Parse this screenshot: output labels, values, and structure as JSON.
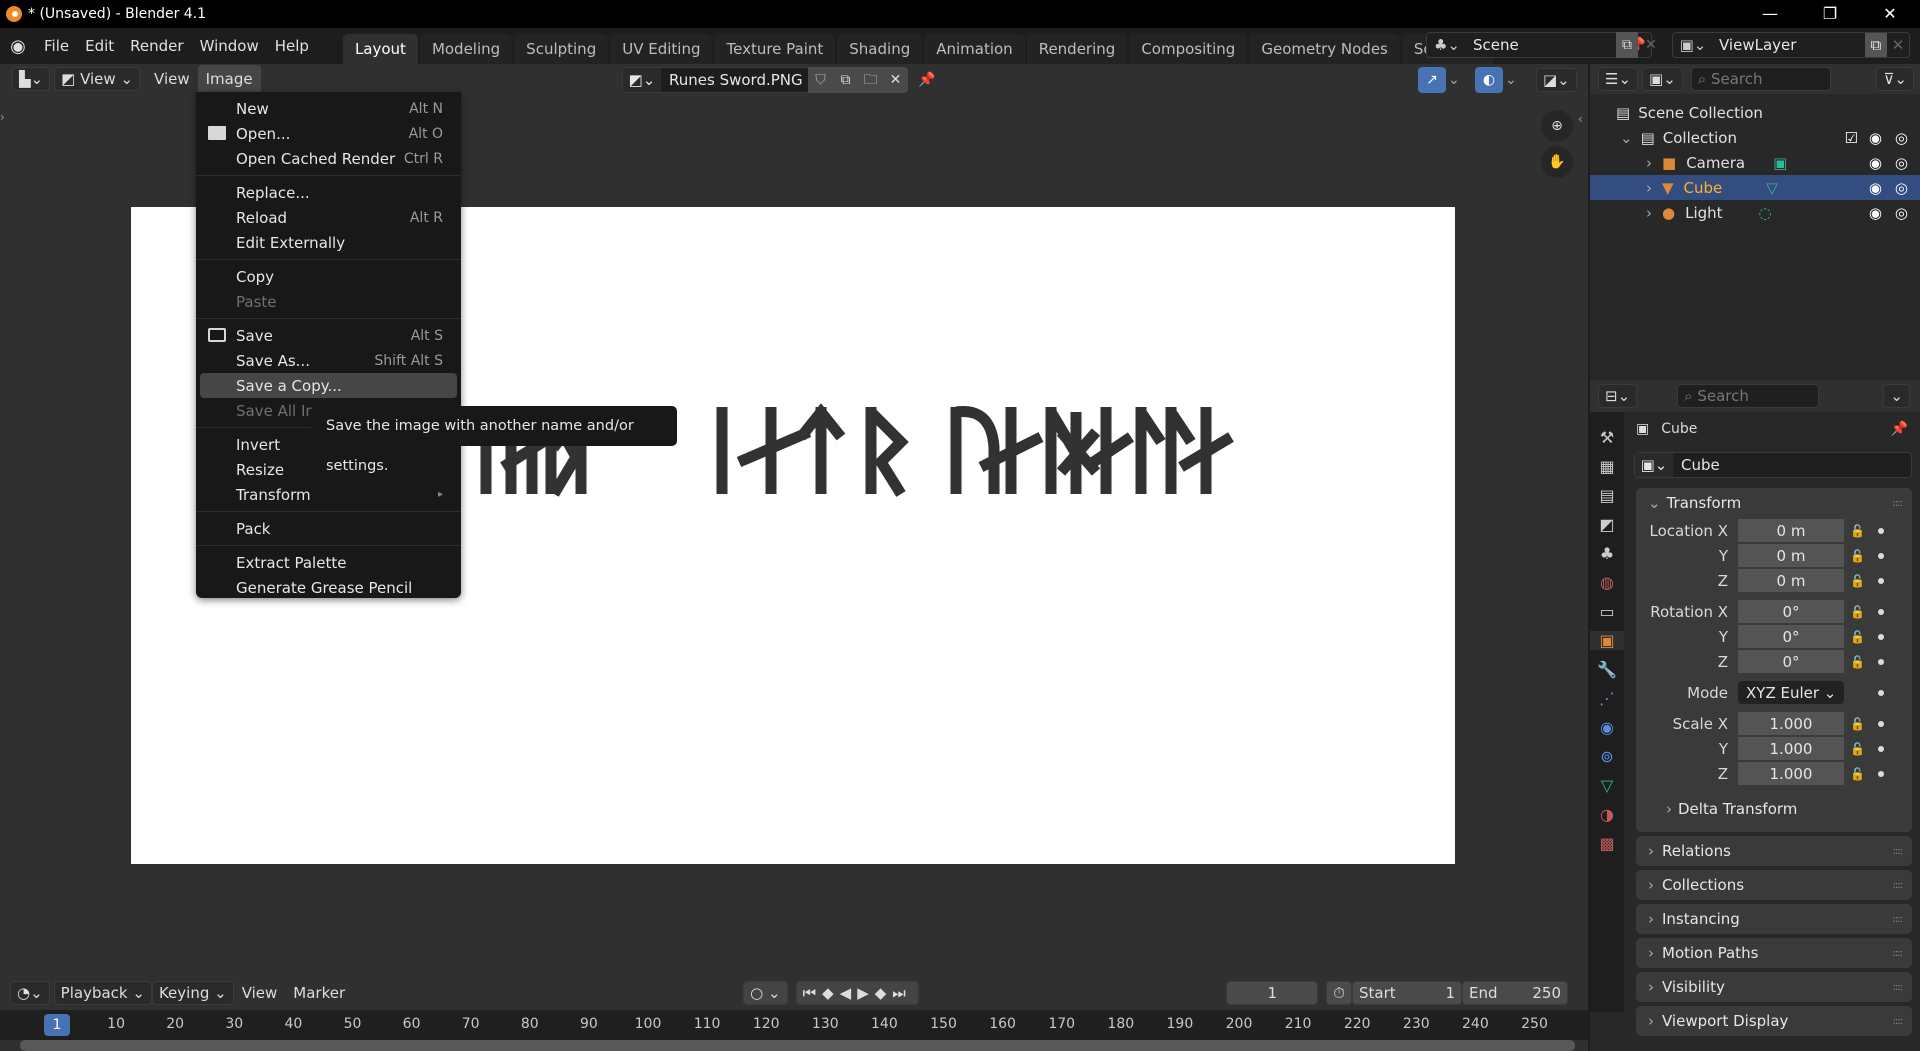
{
  "window": {
    "title": "* (Unsaved) - Blender 4.1",
    "controls": [
      "minimize",
      "restore",
      "close"
    ]
  },
  "topbar": {
    "menus": [
      "File",
      "Edit",
      "Render",
      "Window",
      "Help"
    ],
    "workspaces": [
      "Layout",
      "Modeling",
      "Sculpting",
      "UV Editing",
      "Texture Paint",
      "Shading",
      "Animation",
      "Rendering",
      "Compositing",
      "Geometry Nodes",
      "Scripting"
    ],
    "active_workspace": "Layout",
    "add_tab": "+",
    "scene": "Scene",
    "view_layer": "ViewLayer"
  },
  "image_editor": {
    "mode_dropdown": "View",
    "menus": [
      "View",
      "Image"
    ],
    "active_menu": "Image",
    "image_name": "Runes Sword.PNG"
  },
  "image_menu": {
    "items": [
      {
        "label": "New",
        "shortcut": "Alt N",
        "icon": ""
      },
      {
        "label": "Open...",
        "shortcut": "Alt O",
        "icon": "folder-icon"
      },
      {
        "label": "Open Cached Render",
        "shortcut": "Ctrl R",
        "icon": ""
      },
      {
        "sep": true
      },
      {
        "label": "Replace...",
        "shortcut": "",
        "icon": ""
      },
      {
        "label": "Reload",
        "shortcut": "Alt R",
        "icon": ""
      },
      {
        "label": "Edit Externally",
        "shortcut": "",
        "icon": ""
      },
      {
        "sep": true
      },
      {
        "label": "Copy",
        "shortcut": "",
        "icon": ""
      },
      {
        "label": "Paste",
        "shortcut": "",
        "icon": "",
        "disabled": true
      },
      {
        "sep": true
      },
      {
        "label": "Save",
        "shortcut": "Alt S",
        "icon": "save-icon"
      },
      {
        "label": "Save As...",
        "shortcut": "Shift Alt S",
        "icon": ""
      },
      {
        "label": "Save a Copy...",
        "shortcut": "",
        "icon": "",
        "highlighted": true
      },
      {
        "label": "Save All Images",
        "shortcut": "",
        "icon": "",
        "disabled": true
      },
      {
        "sep": true
      },
      {
        "label": "Invert",
        "shortcut": "",
        "icon": ""
      },
      {
        "label": "Resize",
        "shortcut": "",
        "icon": ""
      },
      {
        "label": "Transform",
        "shortcut": "▸",
        "icon": ""
      },
      {
        "sep": true
      },
      {
        "label": "Pack",
        "shortcut": "",
        "icon": ""
      },
      {
        "sep": true
      },
      {
        "label": "Extract Palette",
        "shortcut": "",
        "icon": ""
      },
      {
        "label": "Generate Grease Pencil",
        "shortcut": "",
        "icon": ""
      }
    ],
    "tooltip": "Save the image with another name and/or settings."
  },
  "outliner": {
    "search_placeholder": "Search",
    "scene_collection": "Scene Collection",
    "collection": "Collection",
    "objects": [
      {
        "name": "Camera",
        "color": "#e0883a",
        "data_color": "#2fb79a",
        "selected": false
      },
      {
        "name": "Cube",
        "color": "#e0883a",
        "data_color": "#2fb79a",
        "selected": true
      },
      {
        "name": "Light",
        "color": "#e0883a",
        "data_color": "#2fb79a",
        "selected": false
      }
    ]
  },
  "properties": {
    "search_placeholder": "Search",
    "object_name": "Cube",
    "datablock": "Cube",
    "transform_title": "Transform",
    "location": {
      "label": "Location X",
      "x": "0 m",
      "y": "0 m",
      "z": "0 m"
    },
    "rotation": {
      "label": "Rotation X",
      "x": "0°",
      "y": "0°",
      "z": "0°"
    },
    "mode_label": "Mode",
    "mode_value": "XYZ Euler",
    "scale": {
      "label": "Scale X",
      "x": "1.000",
      "y": "1.000",
      "z": "1.000"
    },
    "axis_y": "Y",
    "axis_z": "Z",
    "delta": "Delta Transform",
    "panels": [
      "Relations",
      "Collections",
      "Instancing",
      "Motion Paths",
      "Visibility",
      "Viewport Display"
    ]
  },
  "timeline": {
    "menus": [
      "Playback",
      "Keying",
      "View",
      "Marker"
    ],
    "current_frame": "1",
    "start_label": "Start",
    "start": "1",
    "end_label": "End",
    "end": "250",
    "ticks": [
      "10",
      "20",
      "30",
      "40",
      "50",
      "60",
      "70",
      "80",
      "90",
      "100",
      "110",
      "120",
      "130",
      "140",
      "150",
      "160",
      "170",
      "180",
      "190",
      "200",
      "210",
      "220",
      "230",
      "240",
      "250"
    ],
    "playhead": "1"
  },
  "colors": {
    "accent": "#4772b3",
    "selection": "#334d80",
    "active_text": "#ffaf29"
  }
}
